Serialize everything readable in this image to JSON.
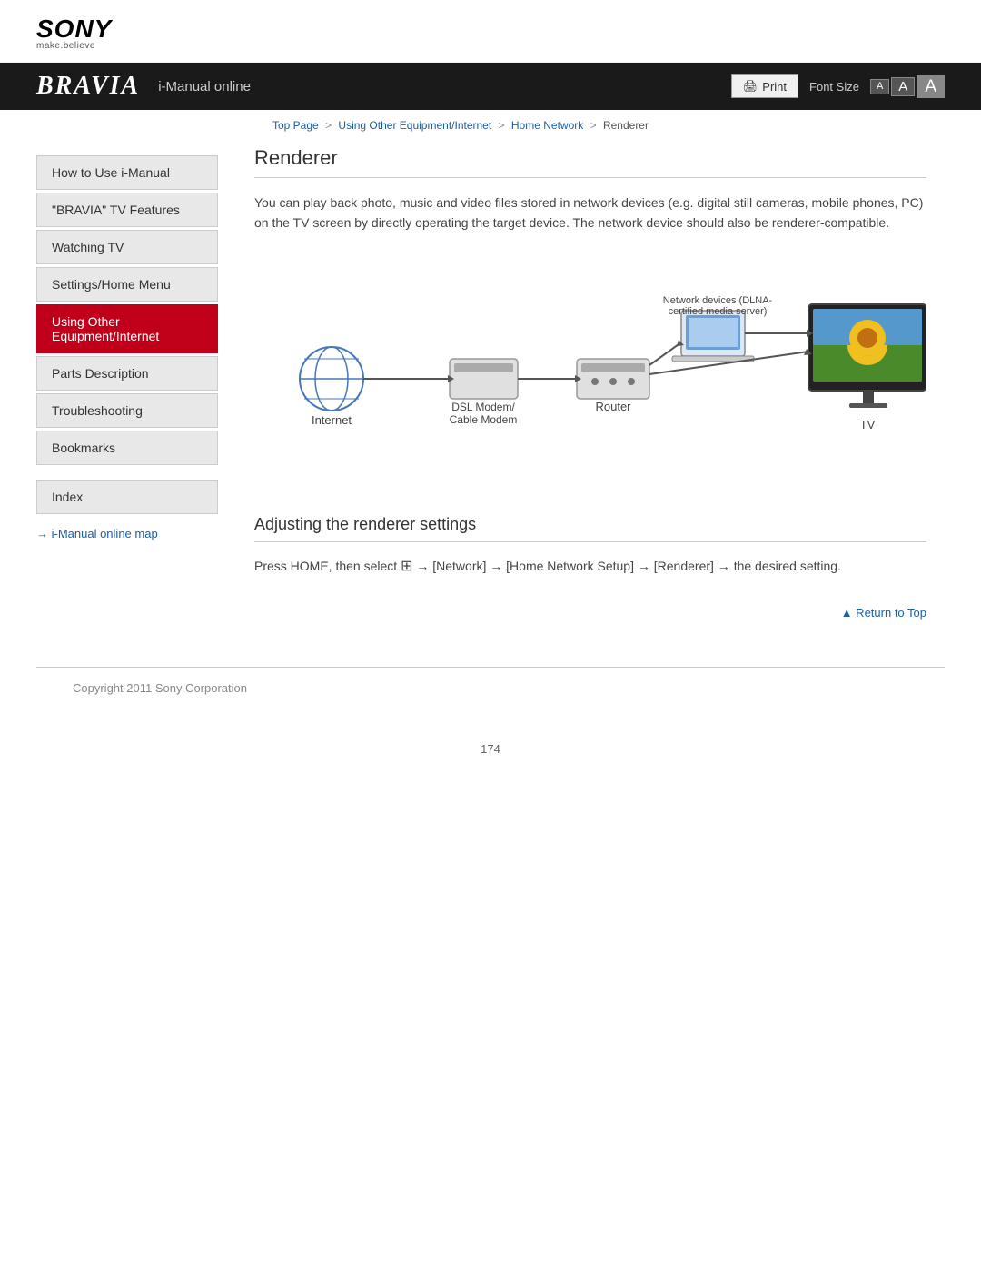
{
  "brand": {
    "name": "SONY",
    "tagline": "make.believe",
    "bravia": "BRAVIA",
    "subtitle": "i-Manual online"
  },
  "toolbar": {
    "print_label": "Print",
    "font_size_label": "Font Size",
    "font_small": "A",
    "font_medium": "A",
    "font_large": "A"
  },
  "breadcrumb": {
    "top_page": "Top Page",
    "sep1": ">",
    "using_other": "Using Other Equipment/Internet",
    "sep2": ">",
    "home_network": "Home Network",
    "sep3": ">",
    "current": "Renderer"
  },
  "sidebar": {
    "items": [
      {
        "label": "How to Use i-Manual",
        "active": false
      },
      {
        "label": "\"BRAVIA\" TV Features",
        "active": false
      },
      {
        "label": "Watching TV",
        "active": false
      },
      {
        "label": "Settings/Home Menu",
        "active": false
      },
      {
        "label": "Using Other Equipment/Internet",
        "active": true
      },
      {
        "label": "Parts Description",
        "active": false
      },
      {
        "label": "Troubleshooting",
        "active": false
      },
      {
        "label": "Bookmarks",
        "active": false
      }
    ],
    "index_label": "Index",
    "map_link": "→ i-Manual online map"
  },
  "content": {
    "page_title": "Renderer",
    "intro_text": "You can play back photo, music and video files stored in network devices (e.g. digital still cameras, mobile phones, PC) on the TV screen by directly operating the target device. The network device should also be renderer-compatible.",
    "diagram": {
      "network_devices_label": "Network devices (DLNA-\ncertified media server)",
      "dsl_modem_label": "DSL Modem/\nCable Modem",
      "internet_label": "Internet",
      "router_label": "Router",
      "tv_label": "TV"
    },
    "section_title": "Adjusting the renderer settings",
    "instruction_text": "Press HOME, then select  → [Network] → [Home Network Setup] → [Renderer] → the desired setting.",
    "return_to_top": "▲ Return to Top"
  },
  "footer": {
    "copyright": "Copyright 2011 Sony Corporation",
    "page_number": "174"
  }
}
